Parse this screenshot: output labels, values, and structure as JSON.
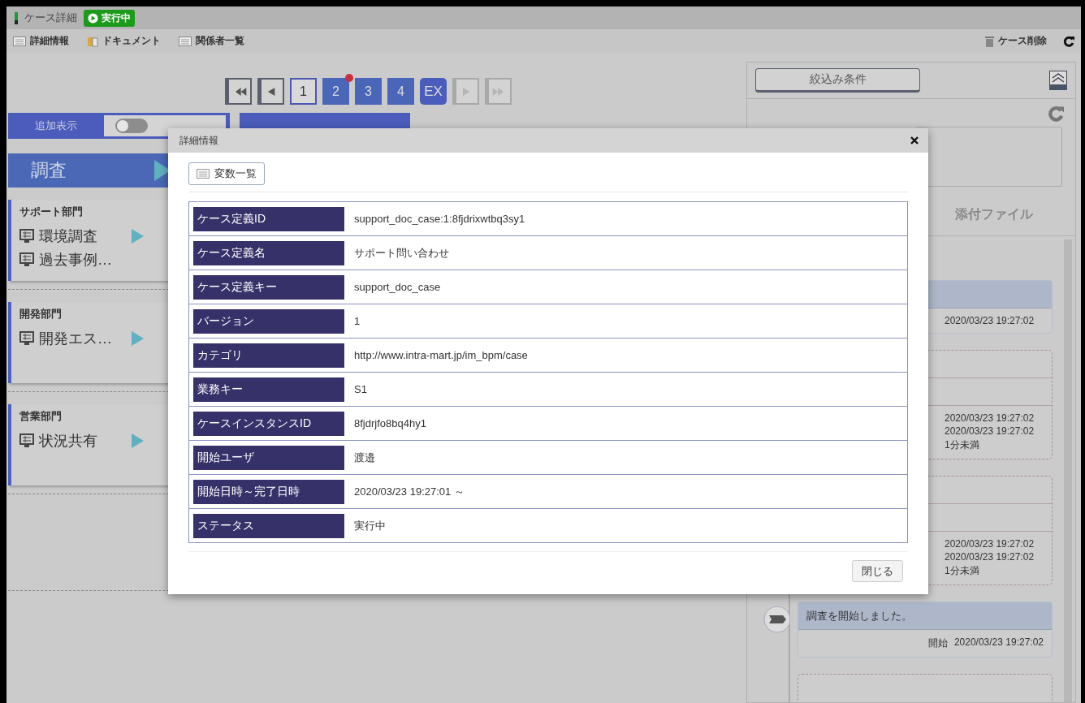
{
  "header": {
    "title": "ケース詳細",
    "status": "実行中"
  },
  "toolbar": {
    "items": [
      {
        "label": "詳細情報",
        "kind": "list"
      },
      {
        "label": "ドキュメント",
        "kind": "binder"
      },
      {
        "label": "関係者一覧",
        "kind": "list"
      }
    ],
    "delete": "ケース削除"
  },
  "pager": {
    "nav_before": [
      {
        "kind": "first",
        "disabled": false
      },
      {
        "kind": "prev",
        "disabled": false
      }
    ],
    "pages": [
      {
        "label": "1",
        "selected": true,
        "notice": false
      },
      {
        "label": "2",
        "selected": false,
        "notice": true
      },
      {
        "label": "3",
        "selected": false,
        "notice": false
      },
      {
        "label": "4",
        "selected": false,
        "notice": false
      }
    ],
    "ex": "EX",
    "nav_after": [
      {
        "kind": "next",
        "disabled": true
      },
      {
        "kind": "last",
        "disabled": true
      }
    ]
  },
  "display_options": {
    "label": "追加表示",
    "toggle_on": false
  },
  "stage": {
    "label": "調査"
  },
  "lanes": [
    {
      "name": "サポート部門",
      "tasks": [
        {
          "label": "環境調査",
          "playable": true
        },
        {
          "label": "過去事例…",
          "playable": false
        }
      ]
    },
    {
      "name": "開発部門",
      "tasks": [
        {
          "label": "開発エス…",
          "playable": true
        }
      ]
    },
    {
      "name": "営業部門",
      "tasks": [
        {
          "label": "状況共有",
          "playable": true
        }
      ]
    }
  ],
  "right_panel": {
    "filter_button": "絞込み条件",
    "tab": "添付ファイル",
    "timeline": [
      {
        "kind": "solid",
        "values": [
          "2020/03/23 19:27:02"
        ]
      },
      {
        "kind": "dashed",
        "values": [
          "2020/03/23 19:27:02",
          "2020/03/23 19:27:02",
          "1分未満"
        ]
      },
      {
        "kind": "dashed",
        "values": [
          "2020/03/23 19:27:02",
          "2020/03/23 19:27:02",
          "1分未満"
        ]
      },
      {
        "kind": "solid",
        "title": "調査を開始しました。",
        "label": "開始",
        "values": [
          "2020/03/23 19:27:02"
        ]
      },
      {
        "kind": "dashed"
      }
    ]
  },
  "dialog": {
    "title": "詳細情報",
    "variables_button": "変数一覧",
    "close_button": "閉じる",
    "rows": [
      {
        "label": "ケース定義ID",
        "value": "support_doc_case:1:8fjdrixwtbq3sy1"
      },
      {
        "label": "ケース定義名",
        "value": "サポート問い合わせ"
      },
      {
        "label": "ケース定義キー",
        "value": "support_doc_case"
      },
      {
        "label": "バージョン",
        "value": "1"
      },
      {
        "label": "カテゴリ",
        "value": "http://www.intra-mart.jp/im_bpm/case"
      },
      {
        "label": "業務キー",
        "value": "S1"
      },
      {
        "label": "ケースインスタンスID",
        "value": "8fjdrjfo8bq4hy1"
      },
      {
        "label": "開始ユーザ",
        "value": "渡邉"
      },
      {
        "label": "開始日時～完了日時",
        "value": "2020/03/23 19:27:01 ～"
      },
      {
        "label": "ステータス",
        "value": "実行中"
      }
    ]
  }
}
